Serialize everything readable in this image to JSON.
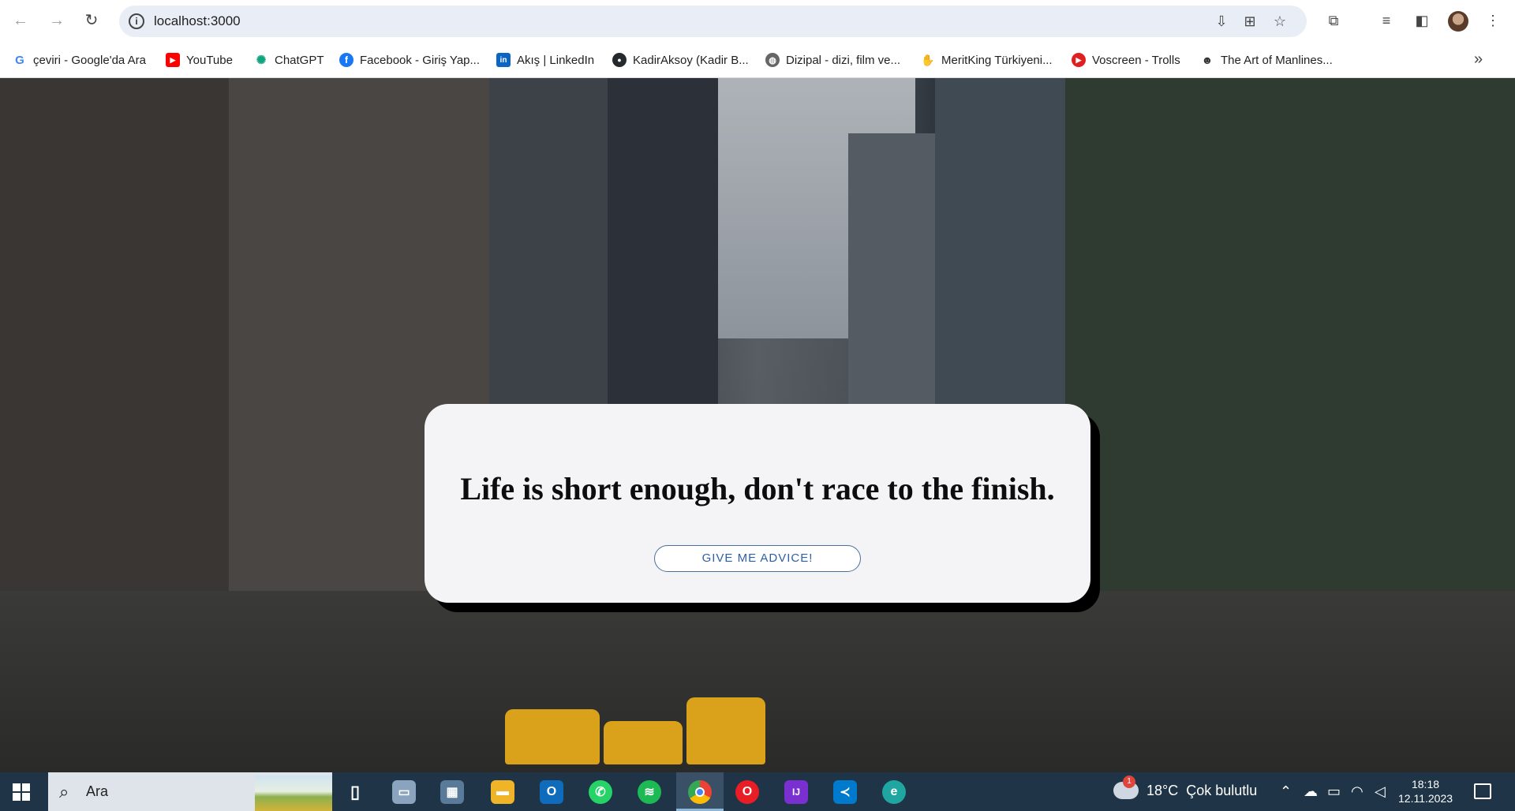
{
  "browser": {
    "url": "localhost:3000",
    "back_icon": "arrow-left-icon",
    "forward_icon": "arrow-right-icon",
    "reload_icon": "reload-icon"
  },
  "bookmarks": [
    {
      "label": "çeviri - Google'da Ara",
      "icon": "G",
      "color": "#4285f4"
    },
    {
      "label": "YouTube",
      "icon": "▶",
      "color": "#ff0000"
    },
    {
      "label": "ChatGPT",
      "icon": "✺",
      "color": "#10a37f"
    },
    {
      "label": "Facebook - Giriş Yap...",
      "icon": "f",
      "color": "#1877f2"
    },
    {
      "label": "Akış | LinkedIn",
      "icon": "in",
      "color": "#0a66c2"
    },
    {
      "label": "KadirAksoy (Kadir B...",
      "icon": "●",
      "color": "#24292e"
    },
    {
      "label": "Dizipal - dizi, film ve...",
      "icon": "◍",
      "color": "#666666"
    },
    {
      "label": "MeritKing Türkiyeni...",
      "icon": "✋",
      "color": "#e8c06a"
    },
    {
      "label": "Voscreen - Trolls",
      "icon": "▶",
      "color": "#e02020"
    },
    {
      "label": "The Art of Manlines...",
      "icon": "☻",
      "color": "#333333"
    }
  ],
  "bookmarks_more": "»",
  "card": {
    "advice": "Life is short enough, don't race to the finish.",
    "button_label": "GIVE ME ADVICE!"
  },
  "taskbar": {
    "search_placeholder": "Ara",
    "weather_temp": "18°C",
    "weather_text": "Çok bulutlu",
    "weather_badge": "1",
    "time": "18:18",
    "date": "12.11.2023",
    "apps": [
      {
        "name": "task-view-icon",
        "color": "#1f3446",
        "glyph": "▯"
      },
      {
        "name": "file-explorer-icon",
        "color": "#8aa4c0",
        "glyph": "▭"
      },
      {
        "name": "calculator-icon",
        "color": "#5a7a9a",
        "glyph": "▦"
      },
      {
        "name": "folder-icon",
        "color": "#f0b429",
        "glyph": "▬"
      },
      {
        "name": "outlook-icon",
        "color": "#0f6cbd",
        "glyph": "O"
      },
      {
        "name": "whatsapp-icon",
        "color": "#25d366",
        "glyph": "✆"
      },
      {
        "name": "spotify-icon",
        "color": "#1db954",
        "glyph": "≋"
      },
      {
        "name": "chrome-icon",
        "color": "#ea4335",
        "glyph": "◉"
      },
      {
        "name": "opera-icon",
        "color": "#e81d25",
        "glyph": "O"
      },
      {
        "name": "intellij-icon",
        "color": "#7a2fd1",
        "glyph": "IJ"
      },
      {
        "name": "vscode-icon",
        "color": "#007acc",
        "glyph": "≺"
      },
      {
        "name": "edge-icon",
        "color": "#1fa6a0",
        "glyph": "e"
      }
    ]
  }
}
